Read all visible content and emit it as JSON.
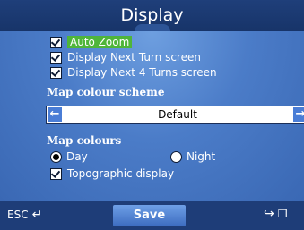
{
  "header": {
    "title": "Display"
  },
  "options": {
    "auto_zoom": {
      "label": "Auto Zoom",
      "checked": true
    },
    "next_turn": {
      "label": "Display Next Turn screen",
      "checked": true
    },
    "next_4_turns": {
      "label": "Display Next 4 Turns screen",
      "checked": true
    }
  },
  "map_colour_scheme": {
    "label": "Map colour scheme",
    "value": "Default"
  },
  "map_colours": {
    "label": "Map colours",
    "day_label": "Day",
    "night_label": "Night",
    "selected": "Day"
  },
  "topographic": {
    "label": "Topographic display",
    "checked": true
  },
  "footer": {
    "esc_label": "ESC",
    "save_label": "Save"
  },
  "colors": {
    "background": "#3a68b4",
    "title_bar": "#1f3f7a",
    "highlight": "#4fb53a",
    "button": "#4a7dd6"
  },
  "icons": [
    "back-arrow-icon",
    "left-arrow-icon",
    "right-arrow-icon",
    "forward-arrow-icon",
    "pages-icon"
  ]
}
